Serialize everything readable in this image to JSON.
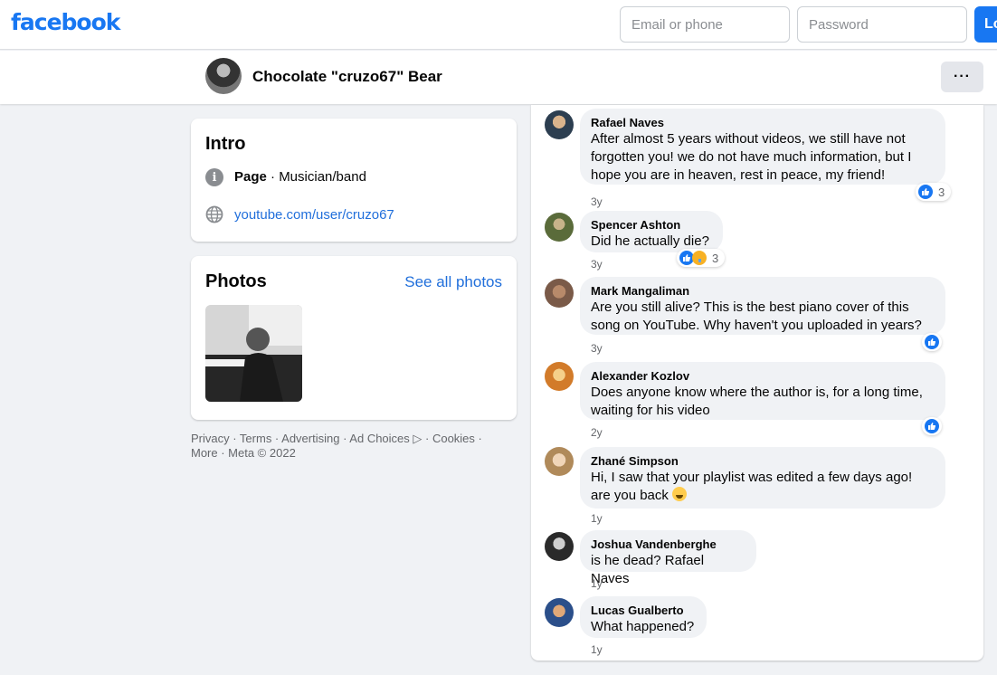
{
  "topbar": {
    "logo": "facebook",
    "email_placeholder": "Email or phone",
    "password_placeholder": "Password",
    "login_label": "Log In"
  },
  "page_header": {
    "name": "Chocolate \"cruzo67\" Bear",
    "more_label": "···"
  },
  "intro": {
    "title": "Intro",
    "category_prefix": "Page",
    "category": " · Musician/band",
    "website": "youtube.com/user/cruzo67"
  },
  "photos": {
    "title": "Photos",
    "see_all": "See all photos"
  },
  "footer": {
    "line1": "Privacy · Terms · Advertising · Ad Choices ▷ · Cookies ·",
    "line2": "More · Meta © 2022"
  },
  "comments": [
    {
      "author": "Rafael Naves",
      "text": "After almost 5 years without videos, we still have not forgotten you! we do not have much information, but I hope you are in heaven, rest in peace, my friend!",
      "time": "3y",
      "reaction_count": "3"
    },
    {
      "author": "Spencer Ashton",
      "text": "Did he actually die?",
      "time": "3y",
      "reaction_count": "3"
    },
    {
      "author": "Mark Mangaliman",
      "text": "Are you still alive? This is the best piano cover of this song on YouTube. Why haven't you uploaded in years?",
      "time": "3y",
      "reaction_count": ""
    },
    {
      "author": "Alexander Kozlov",
      "text": "Does anyone know where the author is, for a long time, waiting for his video",
      "time": "2y",
      "reaction_count": ""
    },
    {
      "author": "Zhané Simpson",
      "text": "Hi, I saw that your playlist was edited a few days ago! are you back",
      "time": "1y",
      "reaction_count": ""
    },
    {
      "author": "Joshua Vandenberghe",
      "text": "is he dead? Rafael Naves",
      "time": "1y",
      "reaction_count": ""
    },
    {
      "author": "Lucas Gualberto",
      "text": "What happened?",
      "time": "1y",
      "reaction_count": ""
    }
  ],
  "colors": {
    "brand": "#1877f2",
    "link": "#216fdb",
    "background": "#f0f2f5"
  }
}
